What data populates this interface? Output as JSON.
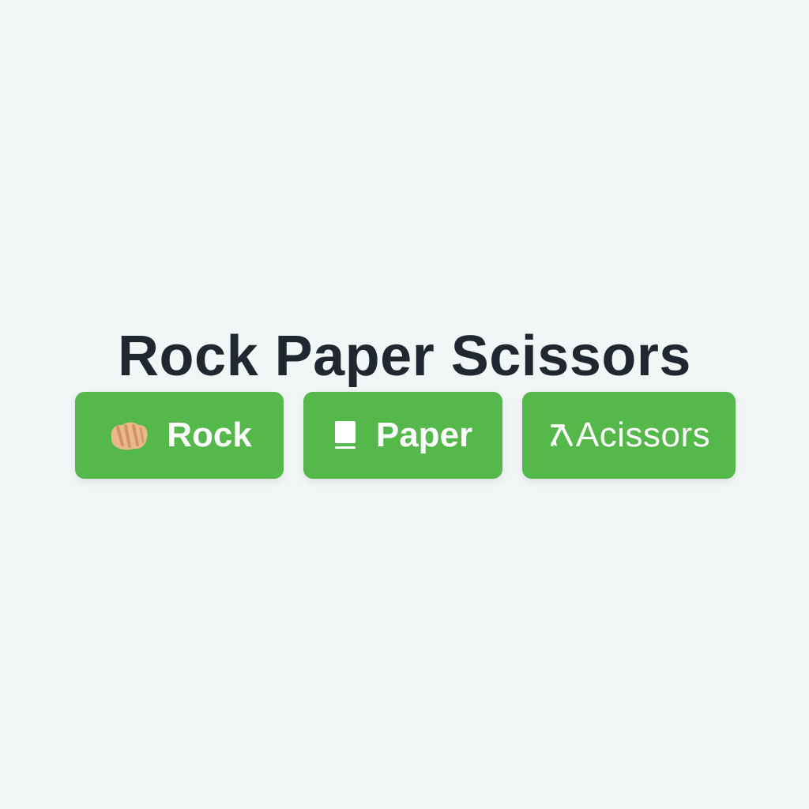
{
  "header": {
    "title": "Rock Paper Scissors"
  },
  "choices": [
    {
      "label": "Rock",
      "icon": "raised-fist-icon"
    },
    {
      "label": "Paper",
      "icon": "page-icon"
    },
    {
      "label": "Acissors",
      "icon": "scissors-icon"
    }
  ],
  "colors": {
    "background": "#f3f6f7",
    "title": "#1f2831",
    "button": "#54b84a",
    "button_text": "#ffffff"
  }
}
